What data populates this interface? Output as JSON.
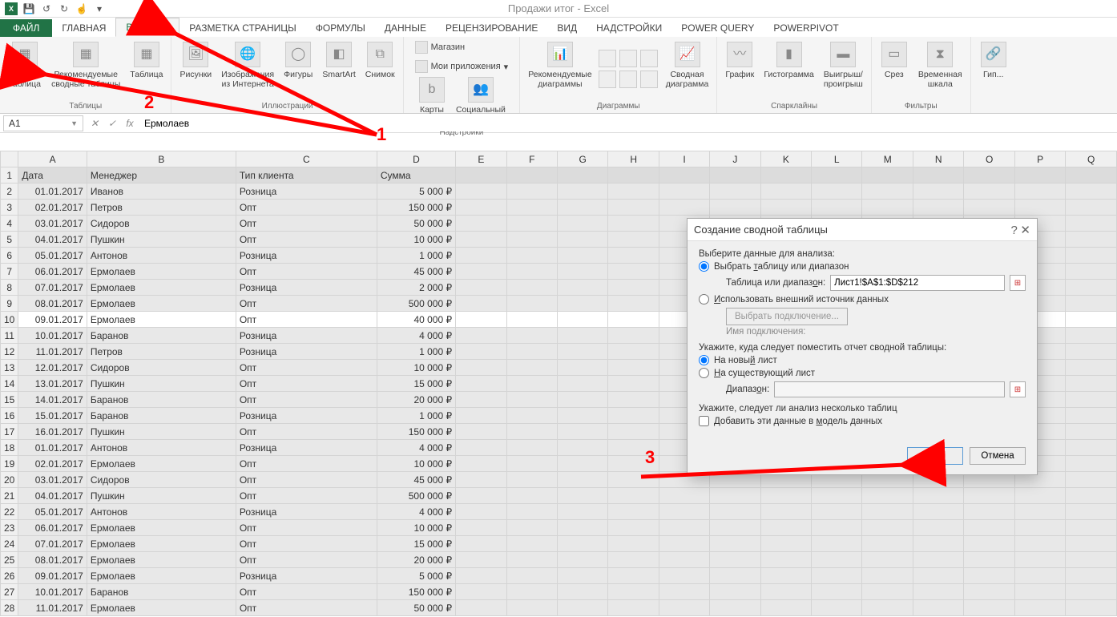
{
  "title": "Продажи итог - Excel",
  "tabs": {
    "file": "ФАЙЛ",
    "home": "ГЛАВНАЯ",
    "insert": "ВСТАВКА",
    "pagelayout": "РАЗМЕТКА СТРАНИЦЫ",
    "formulas": "ФОРМУЛЫ",
    "data": "ДАННЫЕ",
    "review": "РЕЦЕНЗИРОВАНИЕ",
    "view": "ВИД",
    "addins": "НАДСТРОЙКИ",
    "powerquery": "POWER QUERY",
    "powerpivot": "POWERPIVOT"
  },
  "ribbon": {
    "groups": {
      "tables": "Таблицы",
      "illustrations": "Иллюстрации",
      "addins_g": "Надстройки",
      "charts": "Диаграммы",
      "sparklines": "Спарклайны",
      "filters": "Фильтры"
    },
    "btns": {
      "pivottable": "Сводная\nтаблица",
      "recommended_pivot": "Рекомендуемые\nсводные таблицы",
      "table": "Таблица",
      "pictures": "Рисунки",
      "online_pics": "Изображения\nиз Интернета",
      "shapes": "Фигуры",
      "smartart": "SmartArt",
      "screenshot": "Снимок",
      "store": "Магазин",
      "myaddins": "Мои приложения",
      "bingmaps": "Карты\nBing",
      "socialgraph": "Социальный\nграф",
      "rec_charts": "Рекомендуемые\nдиаграммы",
      "pivot_chart": "Сводная\nдиаграмма",
      "chart_line": "График",
      "chart_histo": "Гистограмма",
      "chart_winloss": "Выигрыш/\nпроигрыш",
      "slicer": "Срез",
      "timeline": "Временная\nшкала"
    }
  },
  "namebox": "A1",
  "formulabar": "Ермолаев",
  "columns": [
    "A",
    "B",
    "C",
    "D",
    "E",
    "F",
    "G",
    "H",
    "I",
    "J",
    "K",
    "L",
    "M",
    "N",
    "O",
    "P",
    "Q"
  ],
  "headers": [
    "Дата",
    "Менеджер",
    "Тип клиента",
    "Сумма"
  ],
  "rows": [
    {
      "n": 1,
      "hdr": true
    },
    {
      "n": 2,
      "d": "01.01.2017",
      "m": "Иванов",
      "t": "Розница",
      "s": "5 000 ₽"
    },
    {
      "n": 3,
      "d": "02.01.2017",
      "m": "Петров",
      "t": "Опт",
      "s": "150 000 ₽"
    },
    {
      "n": 4,
      "d": "03.01.2017",
      "m": "Сидоров",
      "t": "Опт",
      "s": "50 000 ₽"
    },
    {
      "n": 5,
      "d": "04.01.2017",
      "m": "Пушкин",
      "t": "Опт",
      "s": "10 000 ₽"
    },
    {
      "n": 6,
      "d": "05.01.2017",
      "m": "Антонов",
      "t": "Розница",
      "s": "1 000 ₽"
    },
    {
      "n": 7,
      "d": "06.01.2017",
      "m": "Ермолаев",
      "t": "Опт",
      "s": "45 000 ₽"
    },
    {
      "n": 8,
      "d": "07.01.2017",
      "m": "Ермолаев",
      "t": "Розница",
      "s": "2 000 ₽"
    },
    {
      "n": 9,
      "d": "08.01.2017",
      "m": "Ермолаев",
      "t": "Опт",
      "s": "500 000 ₽"
    },
    {
      "n": 10,
      "d": "09.01.2017",
      "m": "Ермолаев",
      "t": "Опт",
      "s": "40 000 ₽",
      "active": true
    },
    {
      "n": 11,
      "d": "10.01.2017",
      "m": "Баранов",
      "t": "Розница",
      "s": "4 000 ₽"
    },
    {
      "n": 12,
      "d": "11.01.2017",
      "m": "Петров",
      "t": "Розница",
      "s": "1 000 ₽"
    },
    {
      "n": 13,
      "d": "12.01.2017",
      "m": "Сидоров",
      "t": "Опт",
      "s": "10 000 ₽"
    },
    {
      "n": 14,
      "d": "13.01.2017",
      "m": "Пушкин",
      "t": "Опт",
      "s": "15 000 ₽"
    },
    {
      "n": 15,
      "d": "14.01.2017",
      "m": "Баранов",
      "t": "Опт",
      "s": "20 000 ₽"
    },
    {
      "n": 16,
      "d": "15.01.2017",
      "m": "Баранов",
      "t": "Розница",
      "s": "1 000 ₽"
    },
    {
      "n": 17,
      "d": "16.01.2017",
      "m": "Пушкин",
      "t": "Опт",
      "s": "150 000 ₽"
    },
    {
      "n": 18,
      "d": "01.01.2017",
      "m": "Антонов",
      "t": "Розница",
      "s": "4 000 ₽"
    },
    {
      "n": 19,
      "d": "02.01.2017",
      "m": "Ермолаев",
      "t": "Опт",
      "s": "10 000 ₽"
    },
    {
      "n": 20,
      "d": "03.01.2017",
      "m": "Сидоров",
      "t": "Опт",
      "s": "45 000 ₽"
    },
    {
      "n": 21,
      "d": "04.01.2017",
      "m": "Пушкин",
      "t": "Опт",
      "s": "500 000 ₽"
    },
    {
      "n": 22,
      "d": "05.01.2017",
      "m": "Антонов",
      "t": "Розница",
      "s": "4 000 ₽"
    },
    {
      "n": 23,
      "d": "06.01.2017",
      "m": "Ермолаев",
      "t": "Опт",
      "s": "10 000 ₽"
    },
    {
      "n": 24,
      "d": "07.01.2017",
      "m": "Ермолаев",
      "t": "Опт",
      "s": "15 000 ₽"
    },
    {
      "n": 25,
      "d": "08.01.2017",
      "m": "Ермолаев",
      "t": "Опт",
      "s": "20 000 ₽"
    },
    {
      "n": 26,
      "d": "09.01.2017",
      "m": "Ермолаев",
      "t": "Розница",
      "s": "5 000 ₽"
    },
    {
      "n": 27,
      "d": "10.01.2017",
      "m": "Баранов",
      "t": "Опт",
      "s": "150 000 ₽"
    },
    {
      "n": 28,
      "d": "11.01.2017",
      "m": "Ермолаев",
      "t": "Опт",
      "s": "50 000 ₽"
    }
  ],
  "dialog": {
    "title": "Создание сводной таблицы",
    "section1": "Выберите данные для анализа:",
    "opt_range": "Выбрать таблицу или диапазон",
    "range_label": "Таблица или диапазон:",
    "range_value": "Лист1!$A$1:$D$212",
    "opt_external": "Использовать внешний источник данных",
    "choose_conn": "Выбрать подключение...",
    "conn_name": "Имя подключения:",
    "section2": "Укажите, куда следует поместить отчет сводной таблицы:",
    "opt_newsheet": "На новый лист",
    "opt_existing": "На существующий лист",
    "dest_label": "Диапазон:",
    "section3": "Укажите, следует ли анализ несколько таблиц",
    "opt_model": "Добавить эти данные в модель данных",
    "ok": "ОК",
    "cancel": "Отмена"
  },
  "annotations": {
    "n1": "1",
    "n2": "2",
    "n3": "3"
  }
}
